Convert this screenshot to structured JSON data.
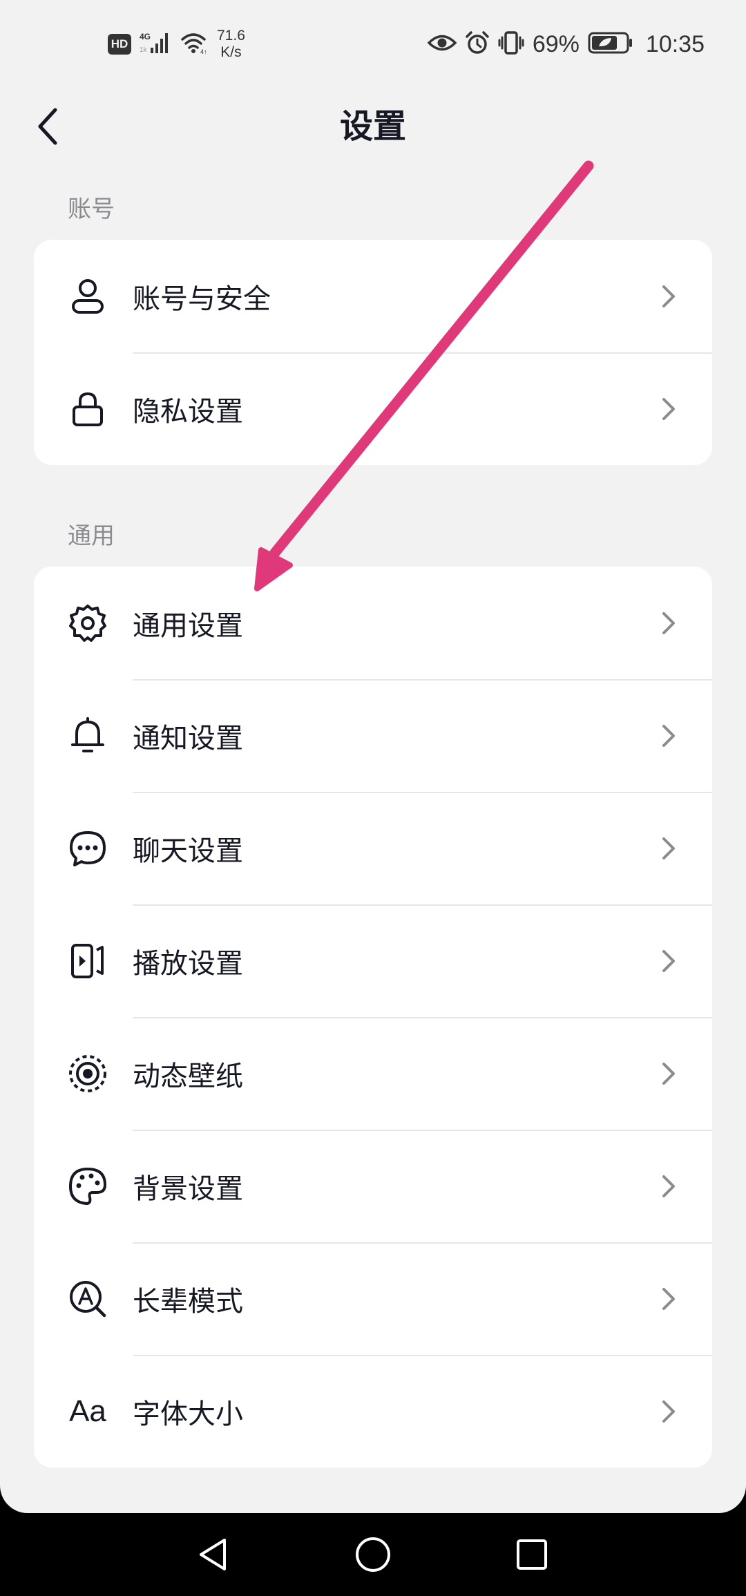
{
  "status_bar": {
    "hd": "HD",
    "network": "4G",
    "net_speed_value": "71.6",
    "net_speed_unit": "K/s",
    "battery_percent": "69%",
    "time": "10:35"
  },
  "header": {
    "title": "设置"
  },
  "sections": [
    {
      "label": "账号",
      "items": [
        {
          "label": "账号与安全",
          "icon": "person-icon"
        },
        {
          "label": "隐私设置",
          "icon": "lock-icon"
        }
      ]
    },
    {
      "label": "通用",
      "items": [
        {
          "label": "通用设置",
          "icon": "gear-icon"
        },
        {
          "label": "通知设置",
          "icon": "bell-icon"
        },
        {
          "label": "聊天设置",
          "icon": "chat-bubble-icon"
        },
        {
          "label": "播放设置",
          "icon": "play-screen-icon"
        },
        {
          "label": "动态壁纸",
          "icon": "dynamic-wallpaper-icon"
        },
        {
          "label": "背景设置",
          "icon": "palette-icon"
        },
        {
          "label": "长辈模式",
          "icon": "elder-mode-icon"
        },
        {
          "label": "字体大小",
          "icon": "font-size-icon",
          "icon_text": "Aa"
        }
      ]
    }
  ],
  "annotation": {
    "color": "#e0397a"
  },
  "colors": {
    "background": "#f2f2f2",
    "card": "#ffffff",
    "text": "#161823",
    "section_label": "#8a8b91",
    "chevron": "#8a8b91"
  }
}
